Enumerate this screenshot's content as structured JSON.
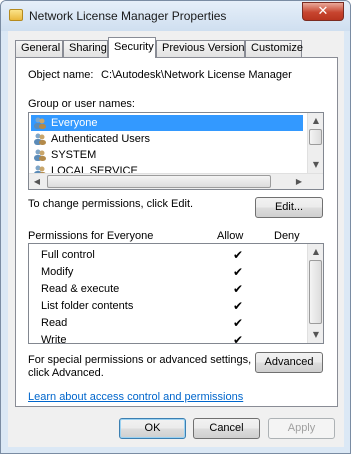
{
  "window": {
    "title": "Network License Manager Properties",
    "close_glyph": "✕"
  },
  "tabs": [
    {
      "label": "General",
      "active": false
    },
    {
      "label": "Sharing",
      "active": false
    },
    {
      "label": "Security",
      "active": true
    },
    {
      "label": "Previous Versions",
      "active": false
    },
    {
      "label": "Customize",
      "active": false
    }
  ],
  "security": {
    "object_name_label": "Object name:",
    "object_name_value": "C:\\Autodesk\\Network License Manager",
    "group_label": "Group or user names:",
    "users": [
      {
        "name": "Everyone",
        "selected": true,
        "icon": "users-group-icon"
      },
      {
        "name": "Authenticated Users",
        "selected": false,
        "icon": "users-group-icon"
      },
      {
        "name": "SYSTEM",
        "selected": false,
        "icon": "users-group-icon"
      },
      {
        "name": "LOCAL SERVICE",
        "selected": false,
        "icon": "users-group-icon"
      }
    ],
    "change_permissions_text": "To change permissions, click Edit.",
    "edit_button": "Edit...",
    "permissions_for_label": "Permissions for Everyone",
    "allow_label": "Allow",
    "deny_label": "Deny",
    "permissions": [
      {
        "name": "Full control",
        "allow": "✔",
        "deny": ""
      },
      {
        "name": "Modify",
        "allow": "✔",
        "deny": ""
      },
      {
        "name": "Read & execute",
        "allow": "✔",
        "deny": ""
      },
      {
        "name": "List folder contents",
        "allow": "✔",
        "deny": ""
      },
      {
        "name": "Read",
        "allow": "✔",
        "deny": ""
      },
      {
        "name": "Write",
        "allow": "✔",
        "deny": ""
      }
    ],
    "special_text_line1": "For special permissions or advanced settings,",
    "special_text_line2": "click Advanced.",
    "advanced_button": "Advanced",
    "learn_link": "Learn about access control and permissions"
  },
  "footer": {
    "ok": "OK",
    "cancel": "Cancel",
    "apply": "Apply"
  },
  "scroll_glyphs": {
    "up": "▲",
    "down": "▼",
    "left": "◀",
    "right": "▶"
  }
}
